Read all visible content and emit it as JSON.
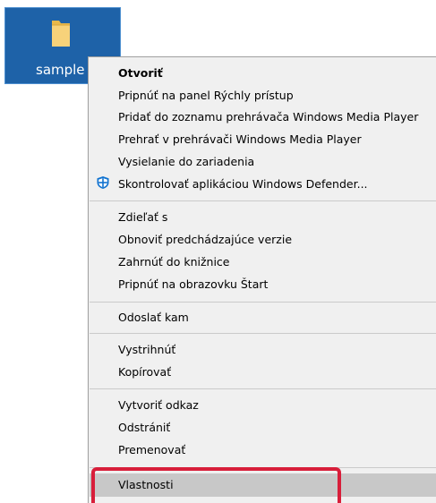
{
  "desktop": {
    "icon_label": "sample"
  },
  "menu": {
    "open": "Otvoriť",
    "pin_quick_access": "Pripnúť na panel Rýchly prístup",
    "add_wmp_list": "Pridať do zoznamu prehrávača Windows Media Player",
    "play_wmp": "Prehrať v prehrávači Windows Media Player",
    "cast_device": "Vysielanie do zariadenia",
    "scan_defender": "Skontrolovať aplikáciou Windows Defender...",
    "share": "Zdieľať s",
    "restore_versions": "Obnoviť predchádzajúce verzie",
    "include_library": "Zahrnúť do knižnice",
    "pin_start": "Pripnúť na obrazovku Štart",
    "send_to": "Odoslať kam",
    "cut": "Vystrihnúť",
    "copy": "Kopírovať",
    "create_shortcut": "Vytvoriť odkaz",
    "delete": "Odstrániť",
    "rename": "Premenovať",
    "properties": "Vlastnosti"
  },
  "colors": {
    "icon_selection": "#1e62a8",
    "menu_background": "#f0f0f0",
    "highlight": "#c8c8c8",
    "callout": "#d81e3a",
    "defender_blue": "#1273d0"
  },
  "icons": {
    "folder": "folder-icon",
    "defender": "windows-defender-icon"
  }
}
